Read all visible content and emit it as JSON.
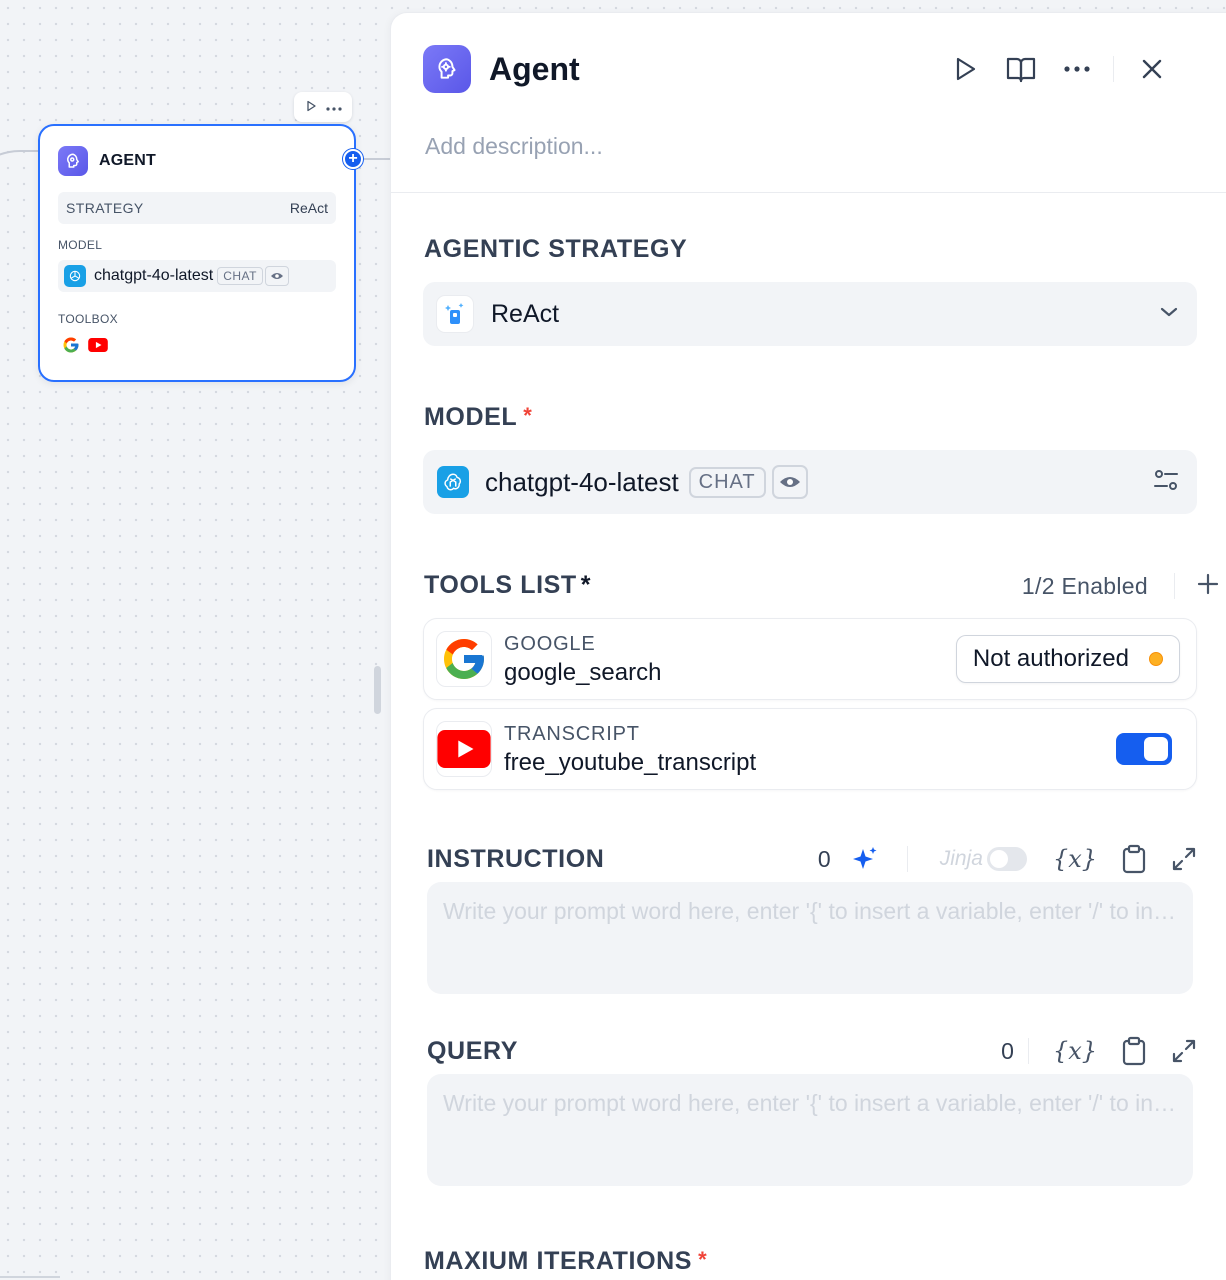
{
  "node": {
    "title": "AGENT",
    "strategy_label": "STRATEGY",
    "strategy_value": "ReAct",
    "model_label": "MODEL",
    "model_name": "chatgpt-4o-latest",
    "model_badge": "CHAT",
    "toolbox_label": "TOOLBOX",
    "tools": [
      "google-icon",
      "youtube-icon"
    ]
  },
  "panel": {
    "title": "Agent",
    "description_placeholder": "Add description...",
    "strategy": {
      "label": "AGENTIC STRATEGY",
      "value": "ReAct"
    },
    "model": {
      "label": "MODEL",
      "required": "*",
      "name": "chatgpt-4o-latest",
      "badge": "CHAT"
    },
    "tools": {
      "label": "TOOLS LIST",
      "required": "*",
      "enabled": "1/2 Enabled",
      "items": [
        {
          "provider": "GOOGLE",
          "name": "google_search",
          "status": "Not authorized",
          "icon": "google-icon"
        },
        {
          "provider": "TRANSCRIPT",
          "name": "free_youtube_transcript",
          "enabled": true,
          "icon": "youtube-icon"
        }
      ]
    },
    "instruction": {
      "label": "INSTRUCTION",
      "count": "0",
      "jinja_label": "Jinja",
      "var_label": "{x}",
      "placeholder": "Write your prompt word here, enter '{' to insert a variable, enter '/' to insert a prompt content block"
    },
    "query": {
      "label": "QUERY",
      "count": "0",
      "var_label": "{x}",
      "placeholder": "Write your prompt word here, enter '{' to insert a variable, enter '/' to insert a prompt content block"
    },
    "max_iterations": {
      "label": "MAXIUM ITERATIONS",
      "required": "*"
    }
  },
  "colors": {
    "accent": "#155eef",
    "node_border": "#2970ff",
    "required": "#f04438",
    "warning_dot": "#fdb022"
  }
}
